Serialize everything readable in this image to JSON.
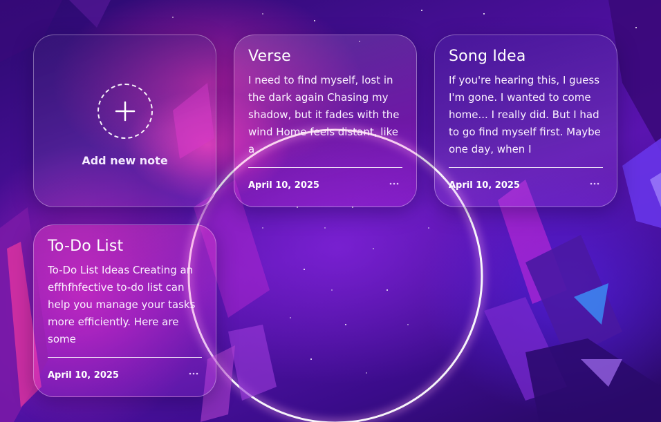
{
  "add_card": {
    "label": "Add new note",
    "icon": "plus-icon"
  },
  "notes": [
    {
      "title": "Verse",
      "body": "I need to find myself, lost in the dark again Chasing my shadow, but it fades with the wind Home feels distant, like a",
      "date": "April 10, 2025",
      "menu_icon": "more-horizontal-icon"
    },
    {
      "title": "Song Idea",
      "body": "If you're hearing this, I guess I'm gone. I wanted to come home... I really did. But I had to go find myself first. Maybe one day, when I",
      "date": "April 10, 2025",
      "menu_icon": "more-horizontal-icon"
    },
    {
      "title": "To-Do List",
      "body": "To-Do List Ideas Creating an effhfhfective to-do list can help you manage your tasks more efficiently. Here are some",
      "date": "April 10, 2025",
      "menu_icon": "more-horizontal-icon"
    }
  ],
  "theme": {
    "background_primary": "#4a0f9a",
    "accent_pink": "#ff28aa",
    "accent_blue": "#5a28ff",
    "text": "#ffffff"
  }
}
